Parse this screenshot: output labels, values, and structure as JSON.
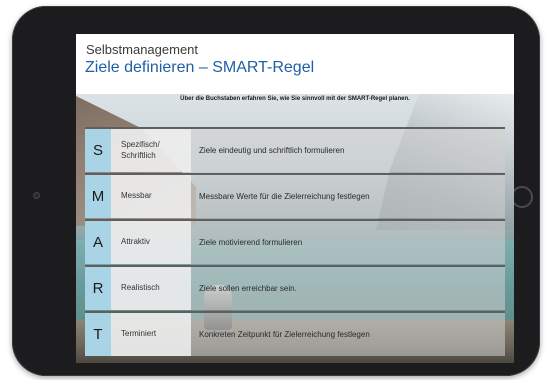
{
  "slide": {
    "overline": "Selbstmanagement",
    "title": "Ziele definieren – SMART-Regel",
    "subtitle": "Über die Buchstaben erfahren Sie, wie Sie sinnvoll mit der SMART-Regel planen."
  },
  "smart_rows": [
    {
      "letter": "S",
      "term": "Spezifisch/\nSchriftlich",
      "description": "Ziele eindeutig und schriftlich formulieren"
    },
    {
      "letter": "M",
      "term": "Messbar",
      "description": "Messbare Werte für die Zielerreichung festlegen"
    },
    {
      "letter": "A",
      "term": "Attraktiv",
      "description": "Ziele motivierend formulieren"
    },
    {
      "letter": "R",
      "term": "Realistisch",
      "description": "Ziele sollen erreichbar sein."
    },
    {
      "letter": "T",
      "term": "Terminiert",
      "description": "Konkreten Zeitpunkt für Zielerreichung festlegen"
    }
  ],
  "colors": {
    "title": "#1f5fa8",
    "letter_cell": "#a8d4e6",
    "device_frame": "#1c1c1e"
  }
}
